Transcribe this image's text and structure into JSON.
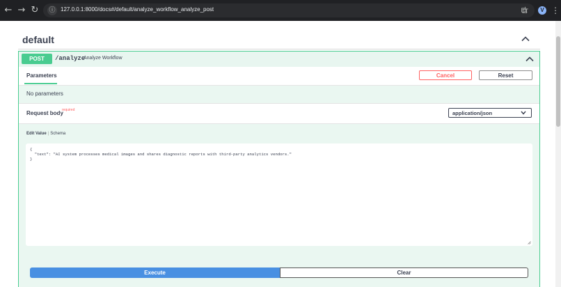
{
  "browser": {
    "back_icon": "←",
    "forward_icon": "→",
    "reload_icon": "↻",
    "site_info_icon": "ⓘ",
    "url": "127.0.0.1:8000/docs#/default/analyze_workflow_analyze_post",
    "star_icon": "☆",
    "extensions_icon": "⧉",
    "avatar_letter": "V",
    "menu_icon": "⋮"
  },
  "section": {
    "title": "default"
  },
  "operation": {
    "method": "POST",
    "path": "/analyze",
    "summary": "Analyze Workflow",
    "parameters_tab": "Parameters",
    "cancel_label": "Cancel",
    "reset_label": "Reset",
    "no_params": "No parameters",
    "request_body_title": "Request body",
    "required_label": "required",
    "content_type": "application/json",
    "edit_value_tab": "Edit Value",
    "schema_tab": "Schema",
    "body_line1": "{",
    "body_line2": "  \"text\": \"AI system processes medical images and shares diagnostic reports with third-party analytics vendors.\"",
    "body_line3": "}",
    "execute_label": "Execute",
    "clear_label": "Clear"
  },
  "colors": {
    "post_green": "#49cc90",
    "execute_blue": "#4990e2",
    "cancel_red": "#ff6060",
    "text_dark": "#3b4151"
  }
}
